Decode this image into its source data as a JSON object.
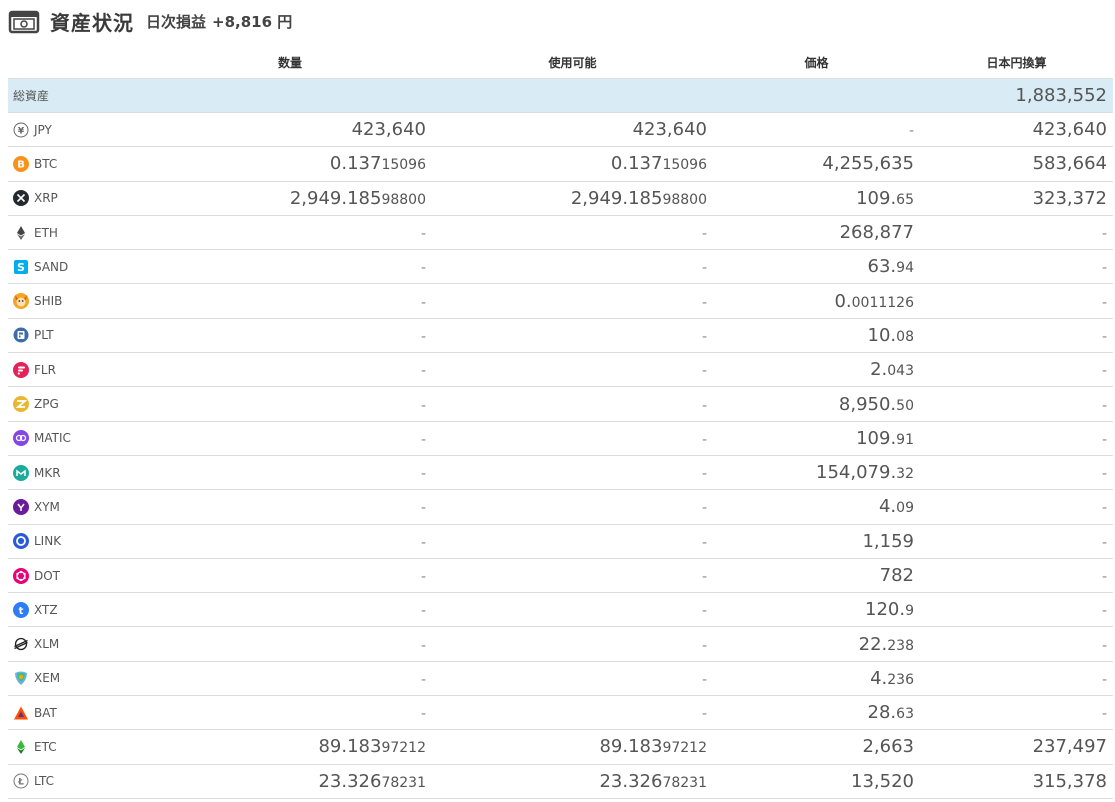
{
  "header": {
    "title": "資産状況",
    "pnl_label": "日次損益",
    "pnl_value": "+8,816 円"
  },
  "columns": {
    "name": "",
    "quantity": "数量",
    "available": "使用可能",
    "price": "価格",
    "jpy_value": "日本円換算"
  },
  "total": {
    "label": "総資産",
    "jpy_value": "1,883,552"
  },
  "rows": [
    {
      "symbol": "JPY",
      "icon": "yen-icon",
      "qty_main": "423,640",
      "qty_sub": "",
      "avail_main": "423,640",
      "avail_sub": "",
      "price_main": "-",
      "price_sub": "",
      "jpy": "423,640"
    },
    {
      "symbol": "BTC",
      "icon": "bitcoin-icon",
      "qty_main": "0.137",
      "qty_sub": "15096",
      "avail_main": "0.137",
      "avail_sub": "15096",
      "price_main": "4,255,635",
      "price_sub": "",
      "jpy": "583,664"
    },
    {
      "symbol": "XRP",
      "icon": "xrp-icon",
      "qty_main": "2,949.185",
      "qty_sub": "98800",
      "avail_main": "2,949.185",
      "avail_sub": "98800",
      "price_main": "109.",
      "price_sub": "65",
      "jpy": "323,372"
    },
    {
      "symbol": "ETH",
      "icon": "ethereum-icon",
      "qty_main": "-",
      "qty_sub": "",
      "avail_main": "-",
      "avail_sub": "",
      "price_main": "268,877",
      "price_sub": "",
      "jpy": "-"
    },
    {
      "symbol": "SAND",
      "icon": "sand-icon",
      "qty_main": "-",
      "qty_sub": "",
      "avail_main": "-",
      "avail_sub": "",
      "price_main": "63.",
      "price_sub": "94",
      "jpy": "-"
    },
    {
      "symbol": "SHIB",
      "icon": "shib-icon",
      "qty_main": "-",
      "qty_sub": "",
      "avail_main": "-",
      "avail_sub": "",
      "price_main": "0.",
      "price_sub": "0011126",
      "jpy": "-"
    },
    {
      "symbol": "PLT",
      "icon": "plt-icon",
      "qty_main": "-",
      "qty_sub": "",
      "avail_main": "-",
      "avail_sub": "",
      "price_main": "10.",
      "price_sub": "08",
      "jpy": "-"
    },
    {
      "symbol": "FLR",
      "icon": "flr-icon",
      "qty_main": "-",
      "qty_sub": "",
      "avail_main": "-",
      "avail_sub": "",
      "price_main": "2.",
      "price_sub": "043",
      "jpy": "-"
    },
    {
      "symbol": "ZPG",
      "icon": "zpg-icon",
      "qty_main": "-",
      "qty_sub": "",
      "avail_main": "-",
      "avail_sub": "",
      "price_main": "8,950.",
      "price_sub": "50",
      "jpy": "-"
    },
    {
      "symbol": "MATIC",
      "icon": "matic-icon",
      "qty_main": "-",
      "qty_sub": "",
      "avail_main": "-",
      "avail_sub": "",
      "price_main": "109.",
      "price_sub": "91",
      "jpy": "-"
    },
    {
      "symbol": "MKR",
      "icon": "mkr-icon",
      "qty_main": "-",
      "qty_sub": "",
      "avail_main": "-",
      "avail_sub": "",
      "price_main": "154,079.",
      "price_sub": "32",
      "jpy": "-"
    },
    {
      "symbol": "XYM",
      "icon": "xym-icon",
      "qty_main": "-",
      "qty_sub": "",
      "avail_main": "-",
      "avail_sub": "",
      "price_main": "4.",
      "price_sub": "09",
      "jpy": "-"
    },
    {
      "symbol": "LINK",
      "icon": "link-icon",
      "qty_main": "-",
      "qty_sub": "",
      "avail_main": "-",
      "avail_sub": "",
      "price_main": "1,159",
      "price_sub": "",
      "jpy": "-"
    },
    {
      "symbol": "DOT",
      "icon": "dot-icon",
      "qty_main": "-",
      "qty_sub": "",
      "avail_main": "-",
      "avail_sub": "",
      "price_main": "782",
      "price_sub": "",
      "jpy": "-"
    },
    {
      "symbol": "XTZ",
      "icon": "xtz-icon",
      "qty_main": "-",
      "qty_sub": "",
      "avail_main": "-",
      "avail_sub": "",
      "price_main": "120.",
      "price_sub": "9",
      "jpy": "-"
    },
    {
      "symbol": "XLM",
      "icon": "xlm-icon",
      "qty_main": "-",
      "qty_sub": "",
      "avail_main": "-",
      "avail_sub": "",
      "price_main": "22.",
      "price_sub": "238",
      "jpy": "-"
    },
    {
      "symbol": "XEM",
      "icon": "xem-icon",
      "qty_main": "-",
      "qty_sub": "",
      "avail_main": "-",
      "avail_sub": "",
      "price_main": "4.",
      "price_sub": "236",
      "jpy": "-"
    },
    {
      "symbol": "BAT",
      "icon": "bat-icon",
      "qty_main": "-",
      "qty_sub": "",
      "avail_main": "-",
      "avail_sub": "",
      "price_main": "28.",
      "price_sub": "63",
      "jpy": "-"
    },
    {
      "symbol": "ETC",
      "icon": "etc-icon",
      "qty_main": "89.183",
      "qty_sub": "97212",
      "avail_main": "89.183",
      "avail_sub": "97212",
      "price_main": "2,663",
      "price_sub": "",
      "jpy": "237,497"
    },
    {
      "symbol": "LTC",
      "icon": "litecoin-icon",
      "qty_main": "23.326",
      "qty_sub": "78231",
      "avail_main": "23.326",
      "avail_sub": "78231",
      "price_main": "13,520",
      "price_sub": "",
      "jpy": "315,378"
    }
  ],
  "colors": {
    "total_row_bg": "#d9ecf5",
    "btc": "#f7931a",
    "xrp": "#23292f",
    "sand": "#00adef",
    "flr": "#e62058",
    "matic": "#8247e5",
    "mkr": "#1aab9b",
    "xym": "#6a1b9a",
    "link": "#2a5ada",
    "dot": "#e6007a",
    "xtz": "#2c7df7",
    "bat": "#ff5000",
    "etc": "#3ab83a"
  }
}
